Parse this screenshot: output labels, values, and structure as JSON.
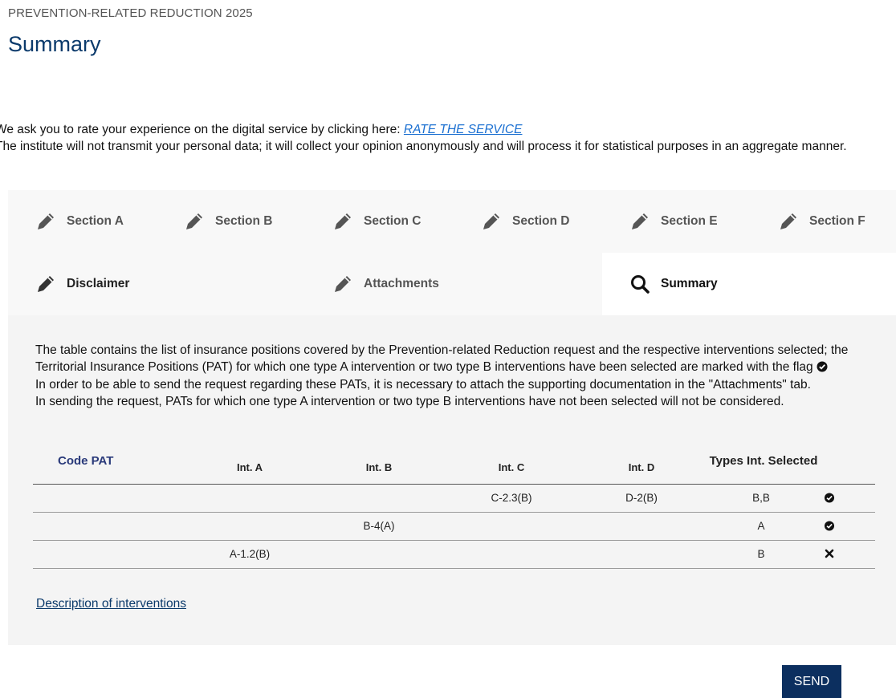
{
  "header": {
    "overline": "PREVENTION-RELATED REDUCTION 2025",
    "title": "Summary"
  },
  "rating": {
    "line1_text": "We ask you to rate your experience on the digital service by clicking here: ",
    "link_label": "RATE THE SERVICE",
    "line2_text": "The institute will not transmit your personal data; it will collect your opinion anonymously and will process it for statistical purposes in an aggregate manner."
  },
  "tabs": {
    "row1": [
      {
        "label": "Section A",
        "icon": "pencil-icon"
      },
      {
        "label": "Section B",
        "icon": "pencil-icon"
      },
      {
        "label": "Section C",
        "icon": "pencil-icon"
      },
      {
        "label": "Section D",
        "icon": "pencil-icon"
      },
      {
        "label": "Section E",
        "icon": "pencil-icon"
      },
      {
        "label": "Section F",
        "icon": "pencil-icon"
      }
    ],
    "row2": [
      {
        "label": "Disclaimer",
        "icon": "pencil-icon"
      },
      {
        "label": "Attachments",
        "icon": "pencil-icon"
      },
      {
        "label": "Summary",
        "icon": "search-icon",
        "active": true
      }
    ]
  },
  "summary": {
    "intro_line1": "The table contains the list of insurance positions covered by the Prevention-related Reduction request and the respective interventions selected; the Territorial Insurance Positions (PAT) for which one type A intervention or two type B interventions have been selected are marked with the flag",
    "intro_line2": "In order to be able to send the request regarding these PATs, it is necessary to attach the supporting documentation in the \"Attachments\" tab.",
    "intro_line3": "In sending the request, PATs for which one type A intervention or two type B interventions have not been selected will not be considered."
  },
  "table": {
    "headers": {
      "code": "Code PAT",
      "int_a": "Int. A",
      "int_b": "Int. B",
      "int_c": "Int. C",
      "int_d": "Int. D",
      "types": "Types Int. Selected"
    },
    "rows": [
      {
        "code": "",
        "int_a": "",
        "int_b": "",
        "int_c": "C-2.3(B)",
        "int_d": "D-2(B)",
        "types": "B,B",
        "status": "check-circle-icon"
      },
      {
        "code": "",
        "int_a": "",
        "int_b": "B-4(A)",
        "int_c": "",
        "int_d": "",
        "types": "A",
        "status": "check-circle-icon"
      },
      {
        "code": "",
        "int_a": "A-1.2(B)",
        "int_b": "",
        "int_c": "",
        "int_d": "",
        "types": "B",
        "status": "x-mark-icon"
      }
    ]
  },
  "links": {
    "description": "Description of interventions"
  },
  "actions": {
    "send_label": "SEND"
  },
  "colors": {
    "primary": "#0b3a6b",
    "button": "#0c2f5f",
    "link": "#1a6fd1"
  }
}
